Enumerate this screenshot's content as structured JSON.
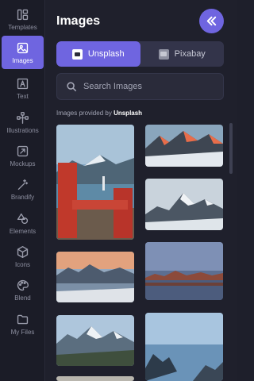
{
  "rail": {
    "items": [
      {
        "label": "Templates",
        "icon": "templates-icon"
      },
      {
        "label": "Images",
        "icon": "image-icon",
        "active": true
      },
      {
        "label": "Text",
        "icon": "text-icon"
      },
      {
        "label": "Illustrations",
        "icon": "illustrations-icon"
      },
      {
        "label": "Mockups",
        "icon": "mockups-icon"
      },
      {
        "label": "Brandify",
        "icon": "magic-wand-icon"
      },
      {
        "label": "Elements",
        "icon": "shapes-icon"
      },
      {
        "label": "Icons",
        "icon": "cube-icon"
      },
      {
        "label": "Blend",
        "icon": "palette-icon"
      },
      {
        "label": "My Files",
        "icon": "folder-icon"
      }
    ]
  },
  "panel": {
    "title": "Images",
    "collapse_icon": "double-chevron-left-icon",
    "tabs": [
      {
        "label": "Unsplash",
        "active": true
      },
      {
        "label": "Pixabay",
        "active": false
      }
    ],
    "search_placeholder": "Search Images",
    "credit_prefix": "Images provided by",
    "credit_source": "Unsplash"
  },
  "colors": {
    "accent": "#6f65e0",
    "background": "#1f202c",
    "rail_background": "#1b1c27"
  }
}
